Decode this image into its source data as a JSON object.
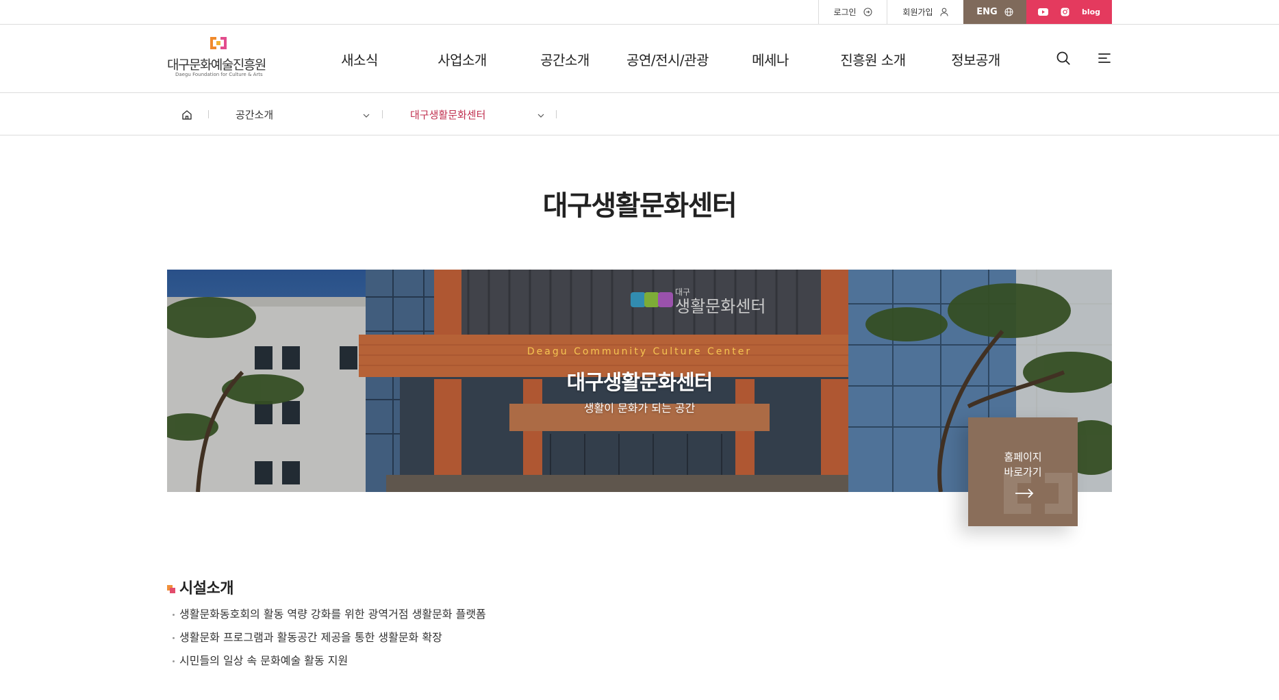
{
  "utility": {
    "login": "로그인",
    "join": "회원가입",
    "eng": "ENG",
    "blog": "blog",
    "sns_color": "#e43a5e",
    "eng_color": "#7f6a5b"
  },
  "logo": {
    "name_ko": "대구문화예술진흥원",
    "name_en": "Daegu Foundation for Culture & Arts"
  },
  "nav": {
    "items": [
      "새소식",
      "사업소개",
      "공간소개",
      "공연/전시/관광",
      "메세나",
      "진흥원 소개",
      "정보공개"
    ]
  },
  "header_icons": [
    "search-icon",
    "menu-icon"
  ],
  "breadcrumb": {
    "level1": "공간소개",
    "level2": "대구생활문화센터",
    "active_color": "#c0304f"
  },
  "page": {
    "title": "대구생활문화센터"
  },
  "banner": {
    "subtitle_en": "Deagu Community Culture Center",
    "title": "대구생활문화센터",
    "tagline": "생활이 문화가 되는 공간",
    "sign_small": "대구",
    "sign_large": "생활문화센터"
  },
  "homepage_button": {
    "line1": "홈페이지",
    "line2": "바로가기",
    "color": "#8a6e5a"
  },
  "facility": {
    "title": "시설소개",
    "items": [
      "생활문화동호회의 활동 역량 강화를 위한 광역거점 생활문화 플랫폼",
      "생활문화 프로그램과 활동공간 제공을 통한 생활문화 확장",
      "시민들의 일상 속 문화예술 활동 지원"
    ]
  }
}
